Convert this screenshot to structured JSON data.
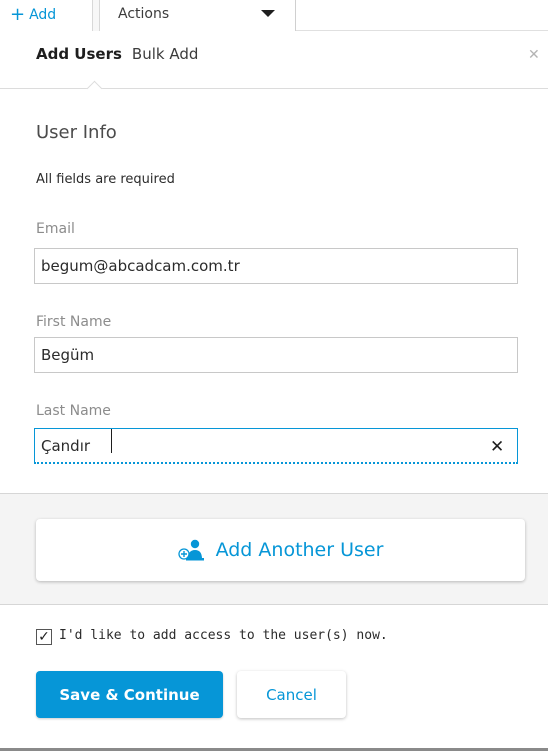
{
  "toolbar": {
    "add_label": "Add",
    "actions_label": "Actions"
  },
  "tabs": {
    "add_users": "Add Users",
    "bulk_add": "Bulk Add"
  },
  "form": {
    "section_title": "User Info",
    "required_note": "All fields are required",
    "email": {
      "label": "Email",
      "value": "begum@abcadcam.com.tr"
    },
    "first_name": {
      "label": "First Name",
      "value": "Begüm"
    },
    "last_name": {
      "label": "Last Name",
      "value": "Çandır"
    }
  },
  "add_another_label": "Add Another User",
  "access_checkbox": {
    "label": "I'd like to add access to the user(s) now.",
    "checked": true
  },
  "buttons": {
    "save": "Save & Continue",
    "cancel": "Cancel"
  },
  "colors": {
    "accent": "#0696d7"
  },
  "icons": {
    "add": "plus-icon",
    "actions_caret": "caret-down-icon",
    "close": "close-icon",
    "clear": "clear-icon",
    "add_user": "add-user-icon",
    "checkbox": "checkmark-icon"
  }
}
